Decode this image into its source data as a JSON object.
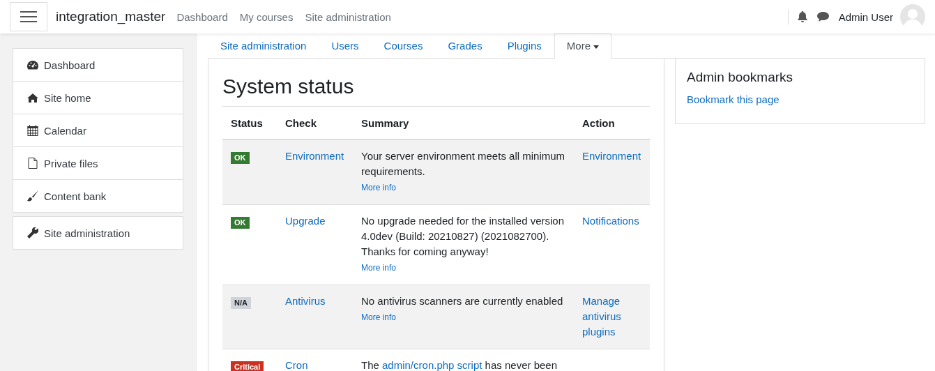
{
  "navbar": {
    "site_name": "integration_master",
    "links": [
      "Dashboard",
      "My courses",
      "Site administration"
    ],
    "user_name": "Admin User"
  },
  "sidebar": {
    "groups": [
      [
        {
          "label": "Dashboard",
          "kind": "gauge"
        },
        {
          "label": "Site home",
          "kind": "home"
        },
        {
          "label": "Calendar",
          "kind": "calendar"
        },
        {
          "label": "Private files",
          "kind": "file"
        },
        {
          "label": "Content bank",
          "kind": "brush"
        }
      ],
      [
        {
          "label": "Site administration",
          "kind": "wrench"
        }
      ]
    ]
  },
  "tabs": [
    {
      "label": "Site administration",
      "selected": false,
      "dropdown": false
    },
    {
      "label": "Users",
      "selected": false,
      "dropdown": false
    },
    {
      "label": "Courses",
      "selected": false,
      "dropdown": false
    },
    {
      "label": "Grades",
      "selected": false,
      "dropdown": false
    },
    {
      "label": "Plugins",
      "selected": false,
      "dropdown": false
    },
    {
      "label": "More",
      "selected": true,
      "dropdown": true
    }
  ],
  "page_title": "System status",
  "table": {
    "columns": [
      "Status",
      "Check",
      "Summary",
      "Action"
    ],
    "rows": [
      {
        "status": "OK",
        "kind": "ok",
        "check": "Environment",
        "summary": "Your server environment meets all minimum requirements.",
        "more_info": "More info",
        "action": "Environment"
      },
      {
        "status": "OK",
        "kind": "ok",
        "check": "Upgrade",
        "summary": "No upgrade needed for the installed version 4.0dev (Build: 20210827) (2021082700). Thanks for coming anyway!",
        "more_info": "More info",
        "action": "Notifications"
      },
      {
        "status": "N/A",
        "kind": "na",
        "check": "Antivirus",
        "summary": "No antivirus scanners are currently enabled",
        "more_info": "More info",
        "action": "Manage antivirus plugins"
      },
      {
        "status": "Critical",
        "kind": "critical",
        "check": "Cron",
        "summary": "The ",
        "summary_link": "admin/cron.php script",
        "summary_after": " has never been"
      }
    ]
  },
  "bookmarks": {
    "title": "Admin bookmarks",
    "link": "Bookmark this page"
  }
}
